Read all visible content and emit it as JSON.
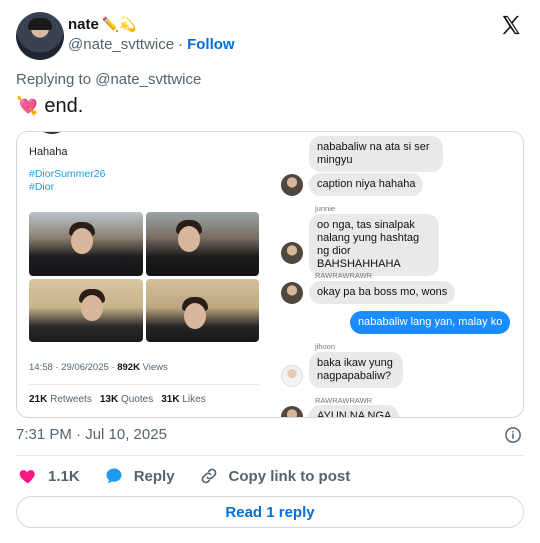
{
  "author": {
    "name": "nate",
    "name_emoji": "✏️💫",
    "handle": "@nate_svttwice",
    "separator": "·",
    "follow_label": "Follow"
  },
  "replying_to": "Replying to @nate_svttwice",
  "tweet": {
    "emoji": "💘",
    "text": "end."
  },
  "embed": {
    "text": "Hahaha",
    "tags": [
      "#DiorSummer26",
      "#Dior"
    ],
    "meta_time": "14:58 · 29/06/2025 · ",
    "meta_views_count": "892K",
    "meta_views_label": " Views",
    "stats": [
      {
        "count": "21K",
        "label": "Retweets"
      },
      {
        "count": "13K",
        "label": "Quotes"
      },
      {
        "count": "31K",
        "label": "Likes"
      }
    ]
  },
  "chat": {
    "messages": [
      {
        "text": "nababaliw na ata si ser mingyu",
        "sender": ""
      },
      {
        "text": "caption niya hahaha",
        "sender": ""
      },
      {
        "text": "oo nga, tas sinalpak nalang yung hashtag ng dior BAHSHAHHAHA",
        "sender": "junnie"
      },
      {
        "text": "okay pa ba boss mo, wons",
        "sender": "RAWRAWRAWR"
      },
      {
        "text": "nababaliw lang yan, malay ko",
        "sender": "me"
      },
      {
        "text": "baka ikaw yung nagpapabaliw?",
        "sender": "jihoon"
      },
      {
        "text": "AYUN NA NGA",
        "sender": "RAWRAWRAWR"
      }
    ]
  },
  "timestamp": "7:31 PM · Jul 10, 2025",
  "actions": {
    "like_count": "1.1K",
    "reply_label": "Reply",
    "copy_label": "Copy link to post"
  },
  "read_reply_label": "Read 1 reply",
  "colors": {
    "accent": "#006fd6",
    "like": "#f91880",
    "reply": "#1d9bf0",
    "chat_mine": "#1a8cff",
    "chat_other": "#e9e9eb"
  }
}
